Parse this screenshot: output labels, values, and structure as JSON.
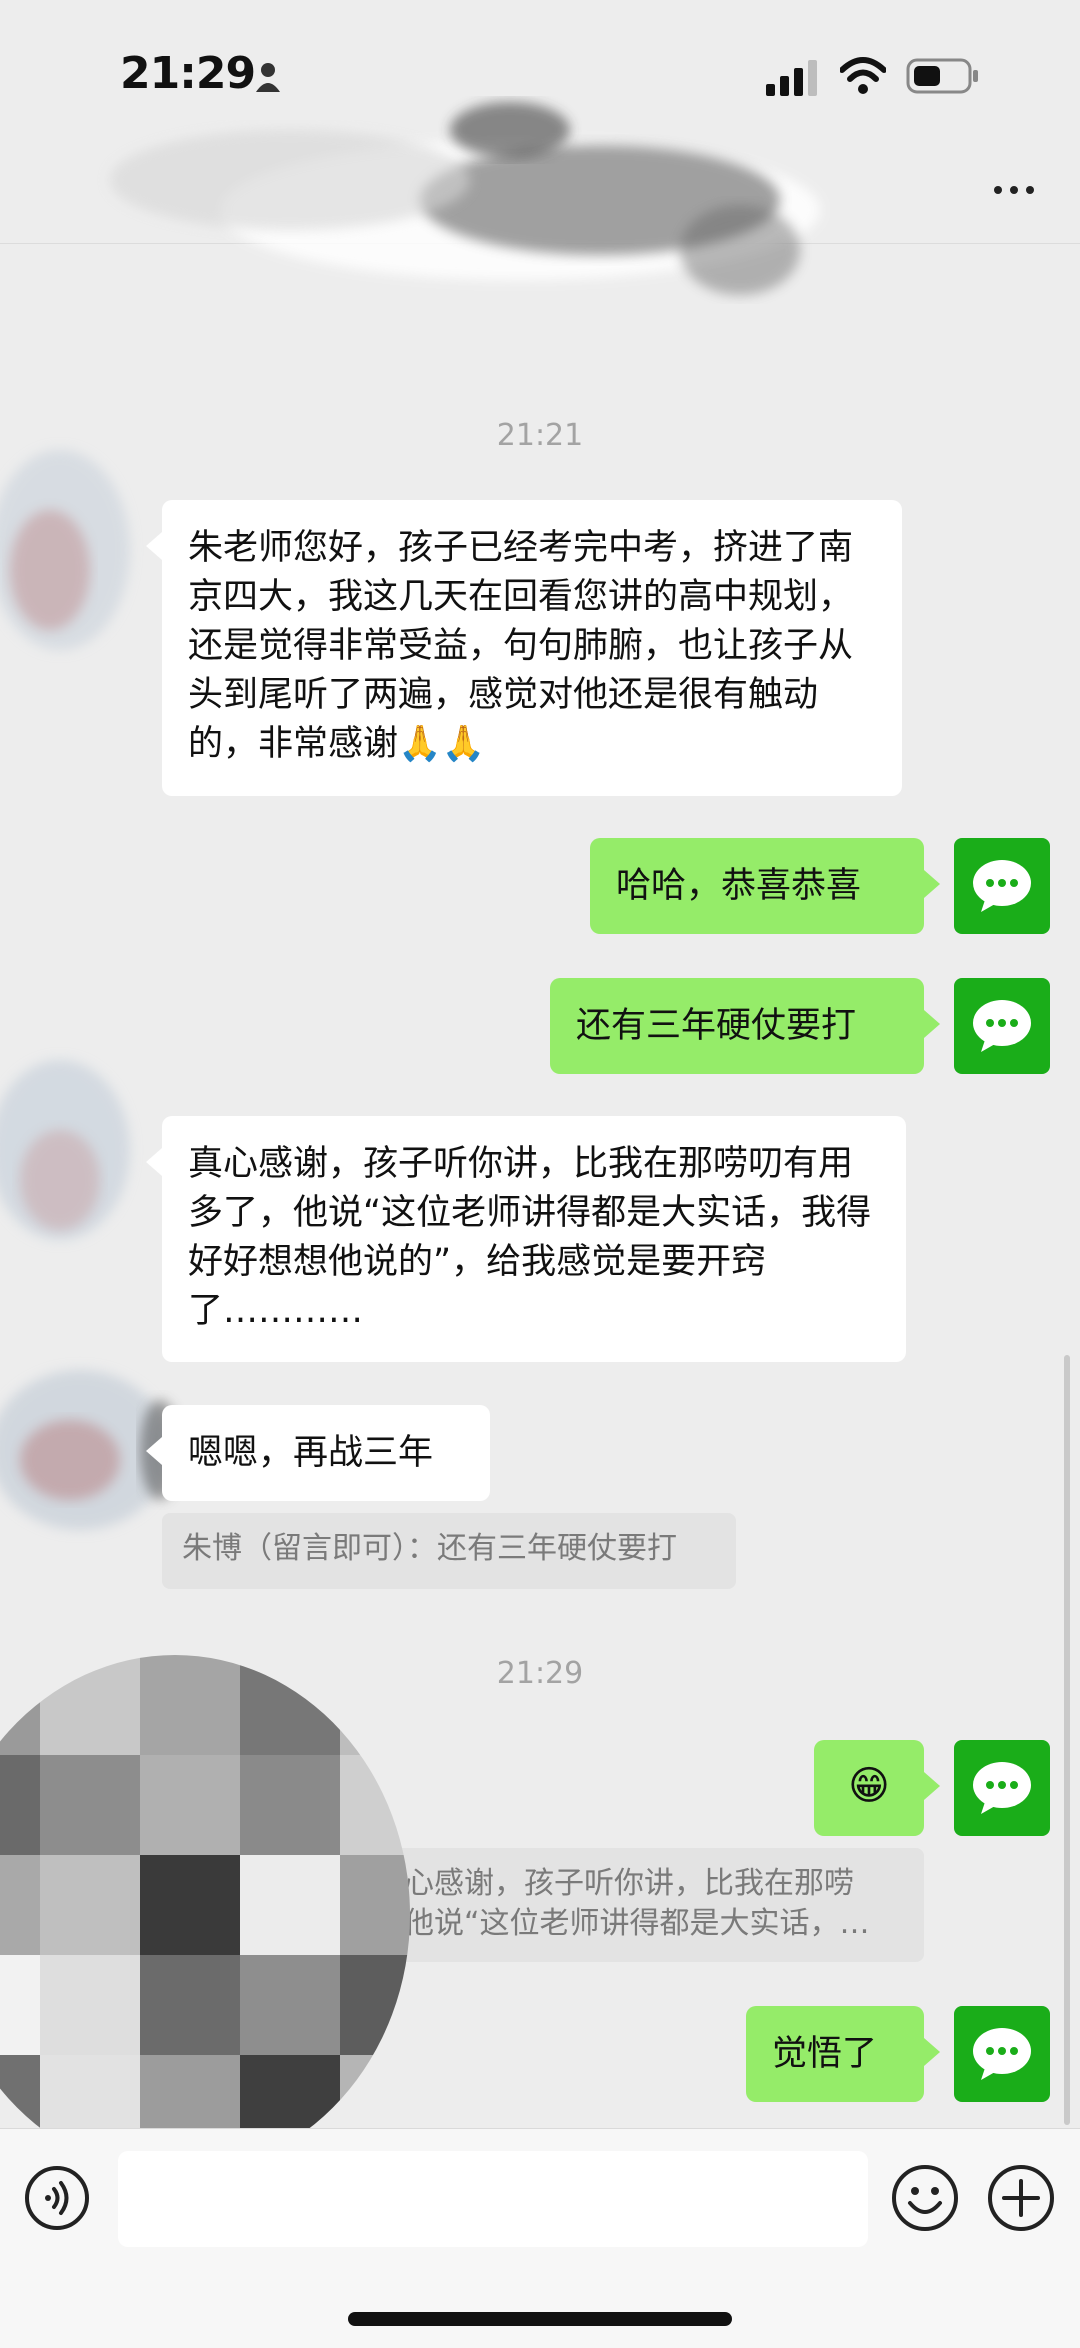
{
  "status_bar": {
    "time": "21:29"
  },
  "timestamps": {
    "first": "21:21",
    "second": "21:29"
  },
  "messages": {
    "m1": "朱老师您好，孩子已经考完中考，挤进了南京四大，我这几天在回看您讲的高中规划，还是觉得非常受益，句句肺腑，也让孩子从头到尾听了两遍，感觉对他还是很有触动的，非常感谢🙏🙏",
    "m2": "哈哈，恭喜恭喜",
    "m3": "还有三年硬仗要打",
    "m4": "真心感谢，孩子听你讲，比我在那唠叨有用多了，他说“这位老师讲得都是大实话，我得好好想想他说的”，给我感觉是要开窍了…………",
    "m5": "嗯嗯，再战三年",
    "m5_quote": "朱博（留言即可）：还有三年硬仗要打",
    "m6": "😁",
    "m6_quote": "心感谢，孩子听你讲，比我在那唠\n他说“这位老师讲得都是大实话，…",
    "m7": "觉悟了"
  },
  "icons": {
    "avatar": "wechat-chat-icon",
    "voice": "voice-icon",
    "emoji": "emoji-icon",
    "plus": "plus-icon",
    "more": "more-icon"
  },
  "colors": {
    "bubble_self": "#95ec69",
    "bubble_other": "#ffffff",
    "avatar": "#1aad19",
    "background": "#ededed"
  }
}
